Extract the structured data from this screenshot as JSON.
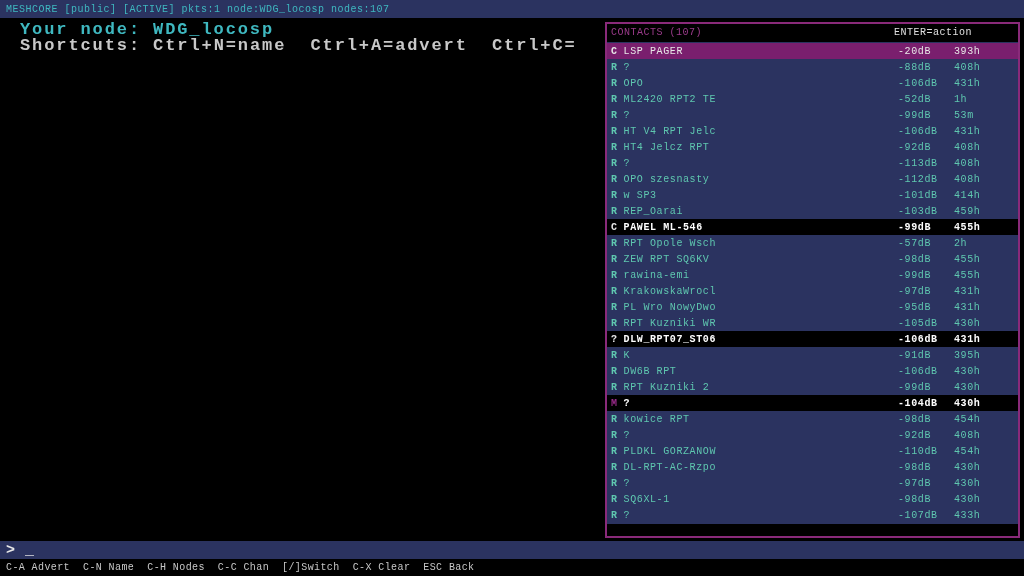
{
  "status_bar": {
    "text": "MESHCORE [public] [ACTIVE] pkts:1 node:WDG_locosp nodes:107"
  },
  "main": {
    "node_label": "Your node:",
    "node_name": "WDG_locosp",
    "shortcuts": "Shortcuts: Ctrl+N=name  Ctrl+A=advert  Ctrl+C="
  },
  "contacts": {
    "title": "CONTACTS (107)",
    "hint": "ENTER=action",
    "rows": [
      {
        "type": "C",
        "color": "#e8e8e8",
        "name": "LSP PAGER",
        "signal": "-20dB",
        "age": "393h",
        "selected": true,
        "highlighted": false
      },
      {
        "type": "R",
        "color": "#5fc8b0",
        "name": "?",
        "signal": "-88dB",
        "age": "408h",
        "selected": false,
        "highlighted": false
      },
      {
        "type": "R",
        "color": "#5fc8b0",
        "name": "OPO",
        "signal": "-106dB",
        "age": "431h",
        "selected": false,
        "highlighted": false
      },
      {
        "type": "R",
        "color": "#5fc8b0",
        "name": "ML2420 RPT2 TE",
        "signal": "-52dB",
        "age": "1h",
        "selected": false,
        "highlighted": false
      },
      {
        "type": "R",
        "color": "#5fc8b0",
        "name": "?",
        "signal": "-99dB",
        "age": "53m",
        "selected": false,
        "highlighted": false
      },
      {
        "type": "R",
        "color": "#5fc8b0",
        "name": "HT V4 RPT Jelc",
        "signal": "-106dB",
        "age": "431h",
        "selected": false,
        "highlighted": false
      },
      {
        "type": "R",
        "color": "#5fc8b0",
        "name": "HT4 Jelcz RPT",
        "signal": "-92dB",
        "age": "408h",
        "selected": false,
        "highlighted": false
      },
      {
        "type": "R",
        "color": "#5fc8b0",
        "name": "?",
        "signal": "-113dB",
        "age": "408h",
        "selected": false,
        "highlighted": false
      },
      {
        "type": "R",
        "color": "#5fc8b0",
        "name": "OPO szesnasty",
        "signal": "-112dB",
        "age": "408h",
        "selected": false,
        "highlighted": false
      },
      {
        "type": "R",
        "color": "#5fc8b0",
        "name": "w SP3",
        "signal": "-101dB",
        "age": "414h",
        "selected": false,
        "highlighted": false
      },
      {
        "type": "R",
        "color": "#5fc8b0",
        "name": "REP_Oarai",
        "signal": "-103dB",
        "age": "459h",
        "selected": false,
        "highlighted": false
      },
      {
        "type": "C",
        "color": "#e8e8e8",
        "name": "PAWEL ML-546",
        "signal": "-99dB",
        "age": "455h",
        "selected": false,
        "highlighted": true
      },
      {
        "type": "R",
        "color": "#5fc8b0",
        "name": "RPT Opole Wsch",
        "signal": "-57dB",
        "age": "2h",
        "selected": false,
        "highlighted": false
      },
      {
        "type": "R",
        "color": "#5fc8b0",
        "name": "ZEW RPT SQ6KV",
        "signal": "-98dB",
        "age": "455h",
        "selected": false,
        "highlighted": false
      },
      {
        "type": "R",
        "color": "#5fc8b0",
        "name": "rawina-emi",
        "signal": "-99dB",
        "age": "455h",
        "selected": false,
        "highlighted": false
      },
      {
        "type": "R",
        "color": "#5fc8b0",
        "name": "KrakowskaWrocl",
        "signal": "-97dB",
        "age": "431h",
        "selected": false,
        "highlighted": false
      },
      {
        "type": "R",
        "color": "#5fc8b0",
        "name": "PL Wro NowyDwo",
        "signal": "-95dB",
        "age": "431h",
        "selected": false,
        "highlighted": false
      },
      {
        "type": "R",
        "color": "#5fc8b0",
        "name": "RPT Kuzniki WR",
        "signal": "-105dB",
        "age": "430h",
        "selected": false,
        "highlighted": false
      },
      {
        "type": "?",
        "color": "#e8e8e8",
        "name": "DLW_RPT07_ST06",
        "signal": "-106dB",
        "age": "431h",
        "selected": false,
        "highlighted": true
      },
      {
        "type": "R",
        "color": "#5fc8b0",
        "name": "K",
        "signal": "-91dB",
        "age": "395h",
        "selected": false,
        "highlighted": false
      },
      {
        "type": "R",
        "color": "#5fc8b0",
        "name": "DW6B RPT",
        "signal": "-106dB",
        "age": "430h",
        "selected": false,
        "highlighted": false
      },
      {
        "type": "R",
        "color": "#5fc8b0",
        "name": "RPT Kuzniki 2",
        "signal": "-99dB",
        "age": "430h",
        "selected": false,
        "highlighted": false
      },
      {
        "type": "M",
        "color": "#9a2a8a",
        "name": "?",
        "signal": "-104dB",
        "age": "430h",
        "selected": false,
        "highlighted": true
      },
      {
        "type": "R",
        "color": "#5fc8b0",
        "name": "kowice RPT",
        "signal": "-98dB",
        "age": "454h",
        "selected": false,
        "highlighted": false
      },
      {
        "type": "R",
        "color": "#5fc8b0",
        "name": "?",
        "signal": "-92dB",
        "age": "408h",
        "selected": false,
        "highlighted": false
      },
      {
        "type": "R",
        "color": "#5fc8b0",
        "name": "PLDKL GORZANOW",
        "signal": "-110dB",
        "age": "454h",
        "selected": false,
        "highlighted": false
      },
      {
        "type": "R",
        "color": "#5fc8b0",
        "name": "DL-RPT-AC-Rzpo",
        "signal": "-98dB",
        "age": "430h",
        "selected": false,
        "highlighted": false
      },
      {
        "type": "R",
        "color": "#5fc8b0",
        "name": "?",
        "signal": "-97dB",
        "age": "430h",
        "selected": false,
        "highlighted": false
      },
      {
        "type": "R",
        "color": "#5fc8b0",
        "name": "SQ6XL-1",
        "signal": "-98dB",
        "age": "430h",
        "selected": false,
        "highlighted": false
      },
      {
        "type": "R",
        "color": "#5fc8b0",
        "name": "?",
        "signal": "-107dB",
        "age": "433h",
        "selected": false,
        "highlighted": false
      }
    ]
  },
  "input": {
    "prompt": ">",
    "value": "_"
  },
  "footer": {
    "items": [
      "C-A Advert",
      "C-N Name",
      "C-H Nodes",
      "C-C Chan",
      "[/]Switch",
      "C-X Clear",
      "ESC Back"
    ]
  }
}
